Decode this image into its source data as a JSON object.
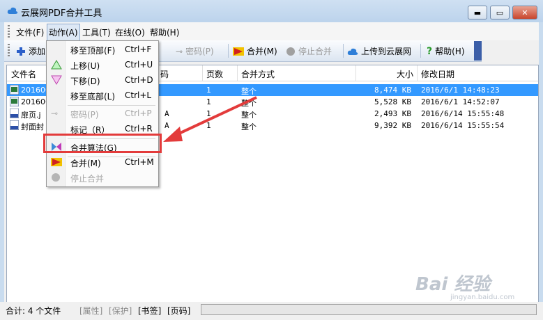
{
  "window": {
    "title": "云展网PDF合并工具",
    "minimize": "▬",
    "maximize": "▭",
    "close": "✕"
  },
  "menubar": {
    "items": [
      "文件(F)",
      "动作(A)",
      "工具(T)",
      "在线(O)",
      "帮助(H)"
    ]
  },
  "toolbar": {
    "add": "添加",
    "password": "密码(P)",
    "merge": "合并(M)",
    "stop": "停止合并",
    "upload": "上传到云展网",
    "help": "帮助(H)"
  },
  "table": {
    "headers": [
      "文件名",
      "码",
      "页数",
      "合并方式",
      "大小",
      "修改日期"
    ],
    "rows": [
      {
        "name": "201606",
        "code": "",
        "pages": "1",
        "mode": "整个",
        "size": "8,474 KB",
        "date": "2016/6/1 14:48:23",
        "selected": true
      },
      {
        "name": "201606",
        "code": "",
        "pages": "1",
        "mode": "整个",
        "size": "5,528 KB",
        "date": "2016/6/1 14:52:07",
        "selected": false
      },
      {
        "name": "扉页.j",
        "code": "A",
        "pages": "1",
        "mode": "整个",
        "size": "2,493 KB",
        "date": "2016/6/14 15:55:48",
        "selected": false
      },
      {
        "name": "封面封",
        "code": "A",
        "pages": "1",
        "mode": "整个",
        "size": "9,392 KB",
        "date": "2016/6/14 15:55:54",
        "selected": false
      }
    ]
  },
  "dropdown": {
    "items": [
      {
        "label": "移至顶部(F)",
        "shortcut": "Ctrl+F",
        "disabled": false
      },
      {
        "label": "上移(U)",
        "shortcut": "Ctrl+U",
        "disabled": false
      },
      {
        "label": "下移(D)",
        "shortcut": "Ctrl+D",
        "disabled": false
      },
      {
        "label": "移至底部(L)",
        "shortcut": "Ctrl+L",
        "disabled": false
      },
      {
        "label": "密码(P)",
        "shortcut": "Ctrl+P",
        "disabled": true
      },
      {
        "label": "标记（R）",
        "shortcut": "Ctrl+R",
        "disabled": false
      },
      {
        "label": "合并算法(G)",
        "shortcut": "",
        "disabled": false
      },
      {
        "label": "合并(M)",
        "shortcut": "Ctrl+M",
        "disabled": false
      },
      {
        "label": "停止合并",
        "shortcut": "",
        "disabled": true
      }
    ]
  },
  "statusbar": {
    "count": "合计: 4 个文件",
    "props": "[属性]",
    "protect": "[保护]",
    "bookmark": "[书签]",
    "pagecode": "[页码]"
  },
  "watermark": {
    "text": "Bai 经验",
    "sub": "jingyan.baidu.com"
  },
  "colors": {
    "selection": "#3399ff",
    "highlight_box": "#e33b3b"
  }
}
